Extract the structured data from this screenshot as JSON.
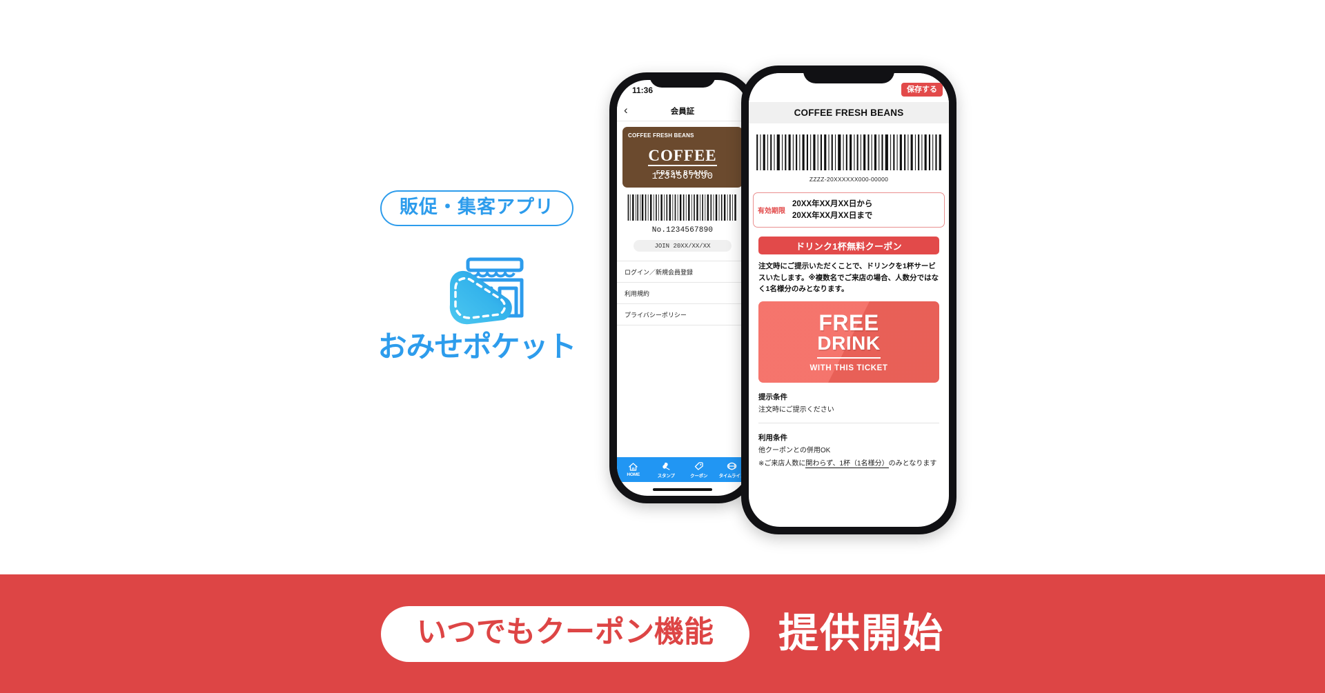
{
  "brand": {
    "badge": "販促・集客アプリ",
    "name": "おみせポケット",
    "accent_color": "#2d9cec",
    "logo_icon": "shop-tag-icon"
  },
  "phone_left": {
    "status_time": "11:36",
    "nav": {
      "back_icon": "chevron-left-icon",
      "title": "会員証"
    },
    "member_card": {
      "shop_name": "COFFEE FRESH BEANS",
      "logo_main": "COFFEE",
      "logo_sub": "FRESH BEANS",
      "card_number": "1234567890",
      "card_color": "#6b4a2e"
    },
    "barcode_number": "No.1234567890",
    "join_label": "JOIN 20XX/XX/XX",
    "menu_items": [
      "ログイン／新規会員登録",
      "利用規約",
      "プライバシーポリシー"
    ],
    "tabs": [
      {
        "label": "HOME",
        "icon": "home-icon"
      },
      {
        "label": "スタンプ",
        "icon": "stamp-icon"
      },
      {
        "label": "クーポン",
        "icon": "coupon-tag-icon"
      },
      {
        "label": "タイムライン",
        "icon": "timeline-icon"
      }
    ],
    "tabbar_color": "#2196f3"
  },
  "phone_right": {
    "save_button": "保存する",
    "shop_header": "COFFEE FRESH BEANS",
    "barcode_number": "ZZZZ-20XXXXXX000-00000",
    "expiry": {
      "label": "有効期限",
      "line1": "20XX年XX月XX日から",
      "line2": "20XX年XX月XX日まで"
    },
    "coupon_title": "ドリンク1杯無料クーポン",
    "coupon_description": "注文時にご提示いただくことで、ドリンクを1杯サービスいたします。※複数名でご来店の場合、人数分ではなく1名様分のみとなります。",
    "ticket": {
      "line1": "FREE",
      "line2": "DRINK",
      "line3": "WITH THIS TICKET",
      "color": "#f4655c"
    },
    "conditions": [
      {
        "heading": "提示条件",
        "text": "注文時にご提示ください"
      },
      {
        "heading": "利用条件",
        "text": "他クーポンとの併用OK",
        "note_prefix": "※ご来店人数に",
        "note_underline": "関わらず、1杯（1名様分）",
        "note_suffix": "のみとなります"
      }
    ],
    "accent_color": "#e24a4a"
  },
  "banner": {
    "pill_text": "いつでもクーポン機能",
    "main_text": "提供開始",
    "background_color": "#dd4545"
  }
}
